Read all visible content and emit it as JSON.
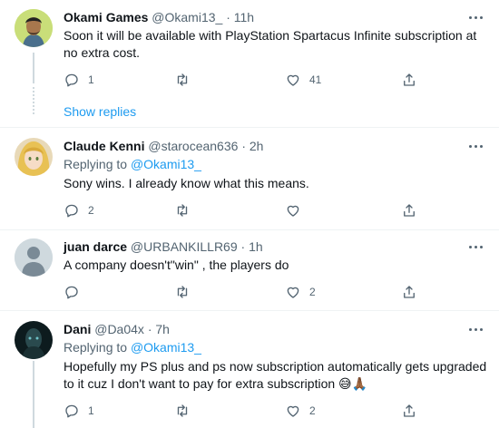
{
  "tweets": [
    {
      "name": "Okami Games",
      "handle": "@Okami13_",
      "time": "11h",
      "text_line1": "Soon it will be available with PlayStation Spartacus Infinite subscription at",
      "text_line2": "no extra cost.",
      "replies": "1",
      "retweets": "",
      "likes": "41"
    },
    {
      "name": "Claude Kenni",
      "handle": "@starocean636",
      "time": "2h",
      "replying_label": "Replying to",
      "replying_handle": "@Okami13_",
      "text_line1": "Sony wins. I already know what this means.",
      "replies": "2",
      "retweets": "",
      "likes": ""
    },
    {
      "name": "juan darce",
      "handle": "@URBANKILLR69",
      "time": "1h",
      "text_line1": "A company doesn't\"win\" , the players do",
      "replies": "",
      "retweets": "",
      "likes": "2"
    },
    {
      "name": "Dani",
      "handle": "@Da04x",
      "time": "7h",
      "replying_label": "Replying to",
      "replying_handle": "@Okami13_",
      "text_line1": "Hopefully my PS plus and ps now subscription automatically gets upgraded",
      "text_line2": "to it cuz I don't want to pay for extra subscription",
      "emoji": "😅🙏🏾",
      "replies": "1",
      "retweets": "",
      "likes": "2"
    }
  ],
  "show_replies": "Show replies",
  "separator": "·",
  "colors": {
    "link": "#1d9bf0",
    "secondary_text": "#536471",
    "divider": "#eff3f4"
  },
  "icons": [
    "reply-icon",
    "retweet-icon",
    "like-icon",
    "share-icon",
    "more-icon"
  ]
}
